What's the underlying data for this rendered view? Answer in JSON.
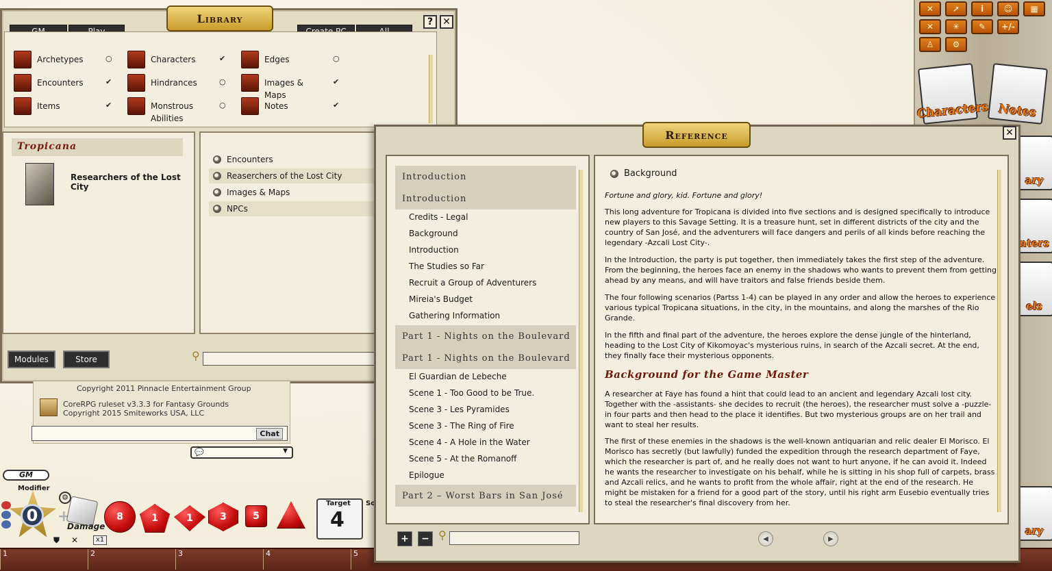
{
  "library": {
    "title": "Library",
    "help_icon": "?",
    "close_icon": "✕",
    "tabs": [
      {
        "label": "GM"
      },
      {
        "label": "Play"
      },
      {
        "label": "Create PC"
      },
      {
        "label": "All"
      }
    ],
    "categories": [
      {
        "label": "Archetypes",
        "mark": "○"
      },
      {
        "label": "Encounters",
        "mark": "✔"
      },
      {
        "label": "Items",
        "mark": "✔"
      },
      {
        "label": "Characters",
        "mark": "✔"
      },
      {
        "label": "Hindrances",
        "mark": "○"
      },
      {
        "label": "Monstrous Abilities",
        "mark": "○"
      },
      {
        "label": "Edges",
        "mark": "○"
      },
      {
        "label": "Images & Maps",
        "mark": "✔"
      },
      {
        "label": "Notes",
        "mark": "✔"
      }
    ],
    "module": {
      "header": "Tropicana",
      "name": "Researchers of the Lost City"
    },
    "sections": [
      {
        "label": "Encounters"
      },
      {
        "label": "Reaserchers of the Lost City"
      },
      {
        "label": "Images & Maps"
      },
      {
        "label": "NPCs"
      }
    ],
    "modules_button": "Modules",
    "store_button": "Store"
  },
  "chat": {
    "lines": [
      "Copyright 2011 Pinnacle Entertainment Group",
      "CoreRPG ruleset v3.3.3 for Fantasy Grounds",
      "Copyright 2015 Smiteworks USA, LLC"
    ],
    "chat_button": "Chat"
  },
  "dice": {
    "gm_label": "GM",
    "modifier_label": "Modifier",
    "modifier_value": "0",
    "damage_label": "Damage",
    "multiplier": "x1",
    "die_values": [
      "8",
      "1",
      "1",
      "3",
      "5"
    ],
    "target_label": "Target",
    "target_value": "4",
    "partial_label": "So"
  },
  "hotbar": {
    "slots": [
      "1",
      "2",
      "3",
      "4",
      "5"
    ]
  },
  "sidebar": {
    "tool_icons": [
      "✕",
      "➚",
      "i",
      "☺",
      "▦",
      "✕",
      "☀",
      "✎",
      "+/-",
      "♙",
      "⚙"
    ],
    "cards": [
      {
        "label": "Characters"
      },
      {
        "label": "Notes"
      }
    ],
    "partial_cards": [
      "ary",
      "nters",
      "els",
      "ary"
    ]
  },
  "reference": {
    "title": "Reference",
    "close_icon": "✕",
    "toc": [
      {
        "type": "head",
        "label": "Introduction"
      },
      {
        "type": "head",
        "label": "Introduction"
      },
      {
        "type": "item",
        "label": "Credits - Legal"
      },
      {
        "type": "item",
        "label": "Background"
      },
      {
        "type": "item",
        "label": "Introduction"
      },
      {
        "type": "item",
        "label": "The Studies so Far"
      },
      {
        "type": "item",
        "label": "Recruit a Group of Adventurers"
      },
      {
        "type": "item",
        "label": "Mireia's Budget"
      },
      {
        "type": "item",
        "label": "Gathering Information"
      },
      {
        "type": "head",
        "label": "Part 1 - Nights on the Boulevard"
      },
      {
        "type": "head",
        "label": "Part 1 - Nights on the Boulevard"
      },
      {
        "type": "item",
        "label": "El Guardian de Lebeche"
      },
      {
        "type": "item",
        "label": "Scene 1 - Too Good to be True."
      },
      {
        "type": "item",
        "label": "Scene 3 - Les Pyramides"
      },
      {
        "type": "item",
        "label": "Scene 3 - The Ring of Fire"
      },
      {
        "type": "item",
        "label": "Scene 4 - A Hole in the Water"
      },
      {
        "type": "item",
        "label": "Scene 5 - At the Romanoff"
      },
      {
        "type": "item",
        "label": "Epilogue"
      },
      {
        "type": "head",
        "label": "Part 2 – Worst Bars in San José"
      }
    ],
    "content": {
      "section_title": "Background",
      "tagline": "Fortune and glory, kid. Fortune and glory!",
      "paragraphs": [
        "This long adventure for Tropicana is divided into five sections and is designed specifically to introduce new players to this Savage Setting. It is a treasure hunt, set in different districts of the city and the country of San José, and the adventurers will face dangers and perils of all kinds before reaching the legendary -Azcali Lost City-.",
        "In the Introduction, the party is put together, then immediately takes the first step of the adventure. From the beginning, the heroes face an enemy in the shadows who wants to prevent them from getting ahead by any means, and will have traitors and false friends beside them.",
        "The four following scenarios (Partss 1-4) can be played in any order and allow the heroes to experience various typical Tropicana situations, in the city, in the mountains, and along the marshes of the Rio Grande.",
        "In the fifth and final part of the adventure, the heroes explore the dense jungle of the hinterland, heading to the Lost City of Kikomoyac's mysterious ruins, in search of the Azcali secret. At the end, they finally face their mysterious opponents."
      ],
      "heading": "Background for the Game Master",
      "paragraphs2": [
        "A researcher at Faye has found a hint that could lead to an ancient and legendary Azcali lost city. Together with the -assistants- she decides to recruit (the heroes), the researcher must solve a -puzzle- in four parts and then head to the place it identifies. But two mysterious groups are on her trail and want to steal her results.",
        "The first of these enemies in the shadows is the well-known antiquarian and relic dealer El Morisco. El Morisco has secretly (but lawfully) funded the expedition through the research department of Faye, which the researcher is part of, and he really does not want to hurt anyone, if he can avoid it. Indeed he wants the researcher to investigate on his behalf, while he is sitting in his shop full of carpets, brass and Azcali relics, and he wants to profit from the whole affair, right at the end of the research. He might be mistaken for a friend for a good part of the story, until his right arm Eusebio eventually tries to steal the researcher's final discovery from her."
      ]
    },
    "plus_label": "+",
    "minus_label": "−"
  }
}
